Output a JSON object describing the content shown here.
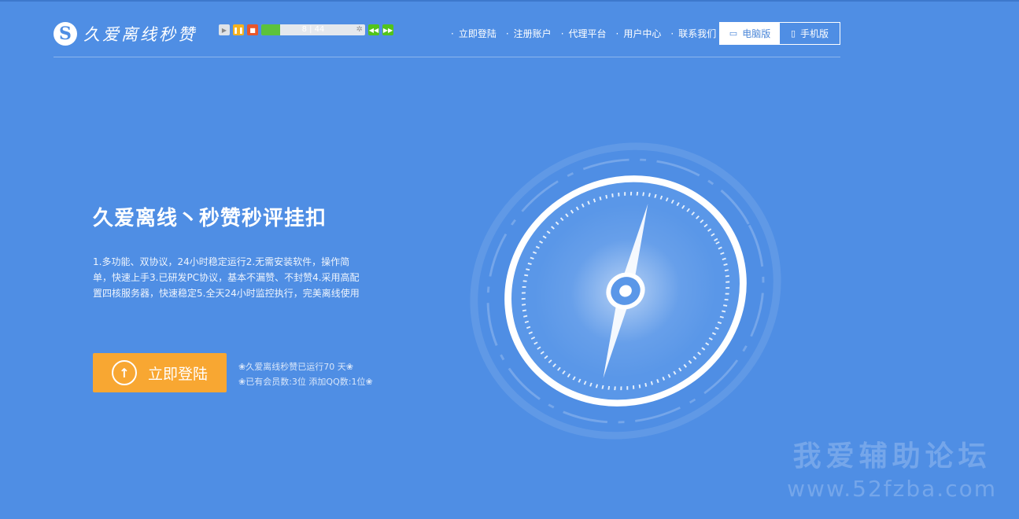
{
  "brand": {
    "logo_letter": "S",
    "name": "久爱离线秒赞"
  },
  "player": {
    "play_icon": "play-icon",
    "pause_icon": "pause-icon",
    "stop_icon": "stop-icon",
    "progress_text": "8 | 44",
    "progress_fraction": 0.18,
    "prev_icon": "rewind-icon",
    "next_icon": "forward-icon"
  },
  "nav": {
    "items": [
      "立即登陆",
      "注册账户",
      "代理平台",
      "用户中心",
      "联系我们"
    ]
  },
  "version": {
    "desktop_label": "电脑版",
    "mobile_label": "手机版",
    "active": "desktop"
  },
  "hero": {
    "title": "久爱离线丶秒赞秒评挂扣",
    "description": "1.多功能、双协议，24小时稳定运行2.无需安装软件，操作简单，快速上手3.已研发PC协议，基本不漏赞、不封赞4.采用高配置四核服务器，快速稳定5.全天24小时监控执行，完美离线使用",
    "login_button": "立即登陆"
  },
  "stats": {
    "line1": "❀久爱离线秒赞已运行70 天❀",
    "line2": "❀已有会员数:3位 添加QQ数:1位❀"
  },
  "watermark": {
    "cn": "我爱辅助论坛",
    "url": "www.52fzba.com"
  },
  "colors": {
    "background": "#4f8ee4",
    "accent_orange": "#f8a732",
    "progress_green": "#5cc23c"
  }
}
